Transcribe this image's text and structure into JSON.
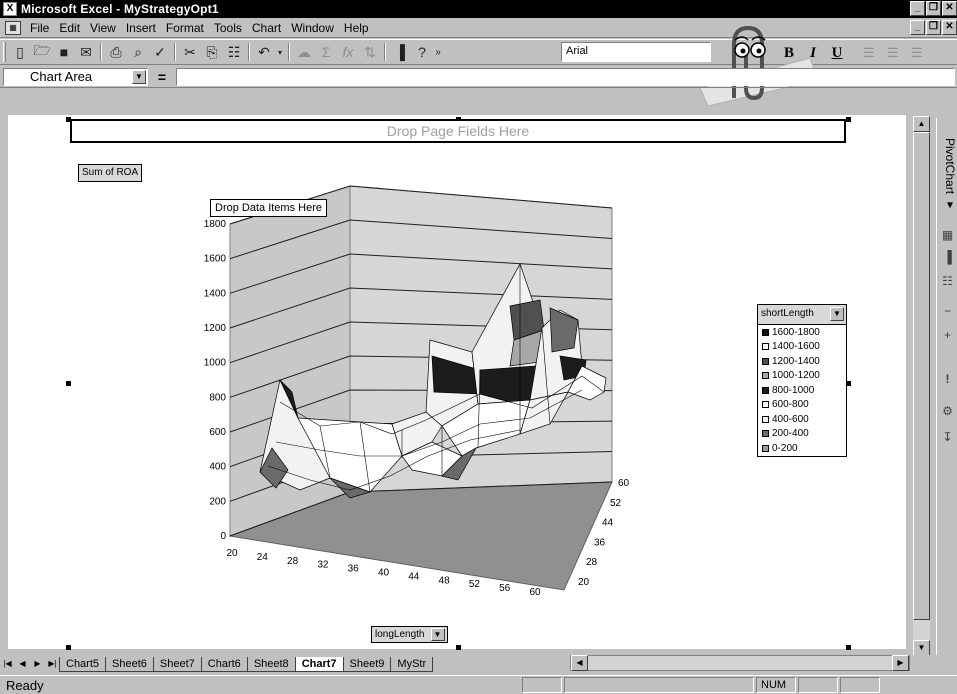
{
  "window": {
    "title": "Microsoft Excel - MyStrategyOpt1"
  },
  "menu": [
    "File",
    "Edit",
    "View",
    "Insert",
    "Format",
    "Tools",
    "Chart",
    "Window",
    "Help"
  ],
  "toolbar": {
    "font": "Arial",
    "bold": "B",
    "italic": "I",
    "underline": "U"
  },
  "formula_bar": {
    "name_box": "Chart Area",
    "equals": "="
  },
  "pivot": {
    "drop_page": "Drop Page Fields Here",
    "data_field": "Sum of ROA",
    "drop_data": "Drop Data Items Here",
    "category_field": "longLength",
    "series_field": "shortLength",
    "panel_title": "PivotChart ▾"
  },
  "chart_data": {
    "type": "surface",
    "title": "",
    "y_axis": {
      "ticks": [
        "0",
        "200",
        "400",
        "600",
        "800",
        "1000",
        "1200",
        "1400",
        "1600",
        "1800"
      ]
    },
    "x_axis": {
      "label": "longLength",
      "ticks": [
        "20",
        "24",
        "28",
        "32",
        "36",
        "40",
        "44",
        "48",
        "52",
        "56",
        "60"
      ]
    },
    "depth_axis": {
      "label": "shortLength",
      "ticks": [
        "20",
        "28",
        "36",
        "44",
        "52",
        "60"
      ]
    },
    "legend": [
      {
        "label": "1600-1800",
        "color": "#101010"
      },
      {
        "label": "1400-1600",
        "color": "#ffffff"
      },
      {
        "label": "1200-1400",
        "color": "#505050"
      },
      {
        "label": "1000-1200",
        "color": "#a8a8a8"
      },
      {
        "label": "800-1000",
        "color": "#1c1c1c"
      },
      {
        "label": "600-800",
        "color": "#ffffff"
      },
      {
        "label": "400-600",
        "color": "#f2f2f2"
      },
      {
        "label": "200-400",
        "color": "#6a6a6a"
      },
      {
        "label": "0-200",
        "color": "#9a9a9a"
      }
    ]
  },
  "sheet_tabs": [
    "Chart5",
    "Sheet6",
    "Sheet7",
    "Chart6",
    "Sheet8",
    "Chart7",
    "Sheet9",
    "MyStr"
  ],
  "active_tab": "Chart7",
  "status": {
    "text": "Ready",
    "num": "NUM"
  }
}
